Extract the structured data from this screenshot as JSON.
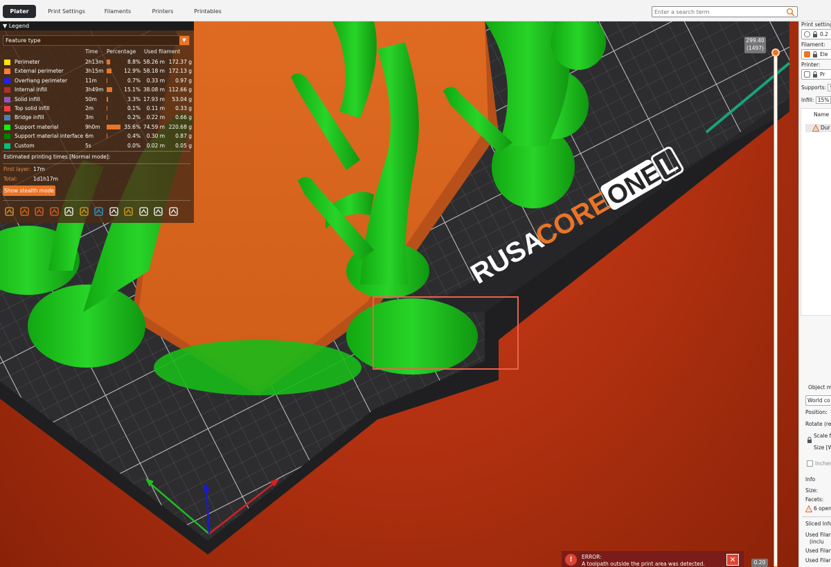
{
  "tabs": {
    "plater": "Plater",
    "print_settings": "Print Settings",
    "filaments": "Filaments",
    "printers": "Printers",
    "printables": "Printables"
  },
  "search": {
    "placeholder": "Enter a search term"
  },
  "scene": {
    "bed_logo_part1": "RUSA",
    "bed_logo_part2": "CORE",
    "bed_logo_part3": "ONE",
    "bed_logo_part4": "L"
  },
  "legend": {
    "title": "Legend",
    "view_type": "Feature type",
    "col_time": "Time",
    "col_percentage": "Percentage",
    "col_used_filament": "Used filament",
    "rows": [
      {
        "name": "Perimeter",
        "time": "2h13m",
        "percent": "8.8%",
        "pct_value": 8.8,
        "meters": "58.26 m",
        "grams": "172.37 g",
        "color": "#ffe600"
      },
      {
        "name": "External perimeter",
        "time": "3h15m",
        "percent": "12.9%",
        "pct_value": 12.9,
        "meters": "58.18 m",
        "grams": "172.13 g",
        "color": "#ff7d38"
      },
      {
        "name": "Overhang perimeter",
        "time": "11m",
        "percent": "0.7%",
        "pct_value": 0.7,
        "meters": "0.33 m",
        "grams": "0.97 g",
        "color": "#1f1fff"
      },
      {
        "name": "Internal infill",
        "time": "3h49m",
        "percent": "15.1%",
        "pct_value": 15.1,
        "meters": "38.08 m",
        "grams": "112.66 g",
        "color": "#b03029"
      },
      {
        "name": "Solid infill",
        "time": "50m",
        "percent": "3.3%",
        "pct_value": 3.3,
        "meters": "17.93 m",
        "grams": "53.04 g",
        "color": "#9654cc"
      },
      {
        "name": "Top solid infill",
        "time": "2m",
        "percent": "0.1%",
        "pct_value": 0.1,
        "meters": "0.11 m",
        "grams": "0.33 g",
        "color": "#f04040"
      },
      {
        "name": "Bridge infill",
        "time": "3m",
        "percent": "0.2%",
        "pct_value": 0.2,
        "meters": "0.22 m",
        "grams": "0.66 g",
        "color": "#4d80ba"
      },
      {
        "name": "Support material",
        "time": "9h0m",
        "percent": "35.6%",
        "pct_value": 35.6,
        "meters": "74.59 m",
        "grams": "220.68 g",
        "color": "#00ff00"
      },
      {
        "name": "Support material interface",
        "time": "6m",
        "percent": "0.4%",
        "pct_value": 0.4,
        "meters": "0.30 m",
        "grams": "0.87 g",
        "color": "#008000"
      },
      {
        "name": "Custom",
        "time": "5s",
        "percent": "0.0%",
        "pct_value": 0.0,
        "meters": "0.02 m",
        "grams": "0.05 g",
        "color": "#00bf7f"
      }
    ],
    "estimated_label": "Estimated printing times [Normal mode]:",
    "first_layer_label": "First layer:",
    "first_layer_value": "17m",
    "total_label": "Total:",
    "total_value": "1d1h17m",
    "stealth_button": "Show stealth mode",
    "visibility_icons": [
      "travel-icon",
      "wipe-icon",
      "retractions-icon",
      "deretractions-icon",
      "seams-icon",
      "tool-changes-icon",
      "color-changes-icon",
      "pause-prints-icon",
      "custom-gcodes-icon",
      "center-of-gravity-icon",
      "shells-icon",
      "tool-marker-icon"
    ]
  },
  "layer_slider": {
    "top_value": "299.40",
    "top_layer": "(1497)",
    "bottom_value": "0.20"
  },
  "error": {
    "title": "ERROR:",
    "message": "A toolpath outside the print area was detected."
  },
  "sidebar": {
    "print_settings_label": "Print setting",
    "print_settings_value": "0.2",
    "filament_label": "Filament:",
    "filament_value": "Ele",
    "printer_label": "Printer:",
    "printer_value": "Pr",
    "supports_label": "Supports:",
    "supports_value": "S",
    "infill_label": "Infill:",
    "infill_value": "15%",
    "name_header": "Name",
    "object_name": "Dur",
    "object_manipulation": "Object m",
    "coords": "World co",
    "position": "Position:",
    "rotate": "Rotate (re",
    "scale": "Scale f",
    "size": "Size [W",
    "inches": "Inches",
    "info": "Info",
    "info_size": "Size:",
    "facets": "Facets:",
    "open_edges": "6 open",
    "sliced_info": "Sliced Info",
    "used_filament_1": "Used Filar",
    "used_filament_1b": "(inclu",
    "used_filament_2": "Used Filar",
    "used_filament_3": "Used Filar"
  },
  "colors": {
    "accent": "#ea7427",
    "support_green": "#1ec81e",
    "model_orange": "#d9651d",
    "bed_dark": "#2b2b2d",
    "background_red": "#b93412"
  }
}
